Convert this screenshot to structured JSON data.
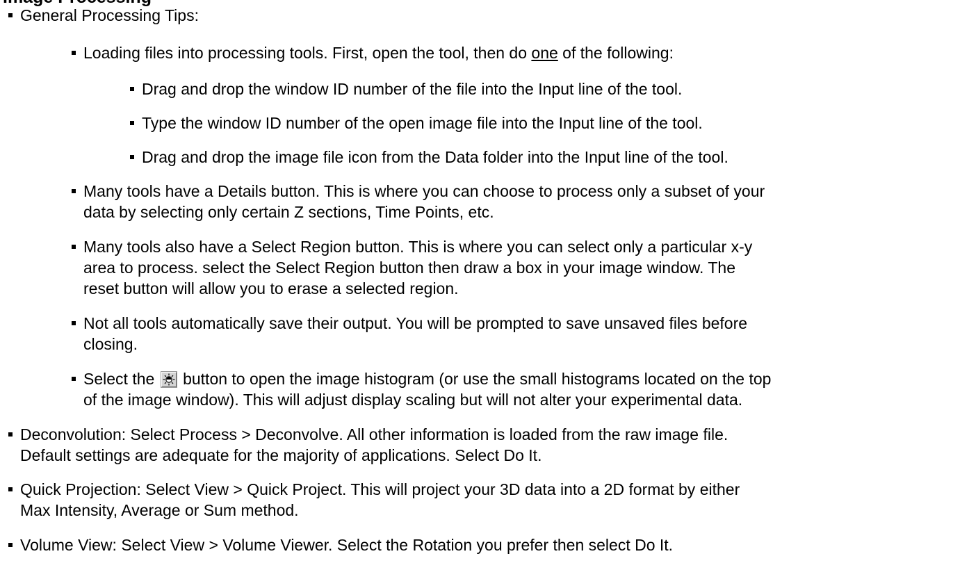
{
  "heading_clip": "Image Processing",
  "items": [
    {
      "text": "General Processing Tips:"
    },
    {
      "before": "Loading files into processing tools. First, open the tool, then do ",
      "underlined": "one",
      "after": " of the following:"
    },
    {
      "text": "Drag and drop the window ID number of the file into the Input line of the tool."
    },
    {
      "text": "Type the window ID number of the open image file into the Input line of the tool."
    },
    {
      "text": "Drag and drop the image file icon from the Data folder into the Input line of the tool."
    },
    {
      "lines": [
        "Many tools have a Details button. This is where you can choose to process only a subset of your",
        "data by selecting only certain Z sections, Time Points, etc."
      ]
    },
    {
      "lines": [
        "Many tools also have a Select Region button. This is where you can select only a particular x-y",
        "area to process. select the Select Region button then draw a box in your image window. The",
        "reset button will allow you to erase a selected region."
      ]
    },
    {
      "lines": [
        "Not all tools automatically save their output. You will be prompted to save unsaved files before",
        "closing."
      ]
    },
    {
      "before": "Select the ",
      "after": " button to open the image histogram (or use the small histograms located on the top",
      "line2": "of the image window). This will adjust display scaling but will not alter your experimental data.",
      "icon": "histogram-icon"
    },
    {
      "lines": [
        "Deconvolution: Select Process > Deconvolve. All other information is loaded from the raw image file.",
        "Default settings are adequate for the majority of applications. Select Do It."
      ]
    },
    {
      "lines": [
        "Quick Projection: Select View > Quick Project. This will project your 3D data into a 2D format by either",
        "Max Intensity, Average or Sum method."
      ]
    },
    {
      "text": "Volume View: Select View > Volume Viewer. Select the Rotation you prefer then select Do It."
    }
  ]
}
